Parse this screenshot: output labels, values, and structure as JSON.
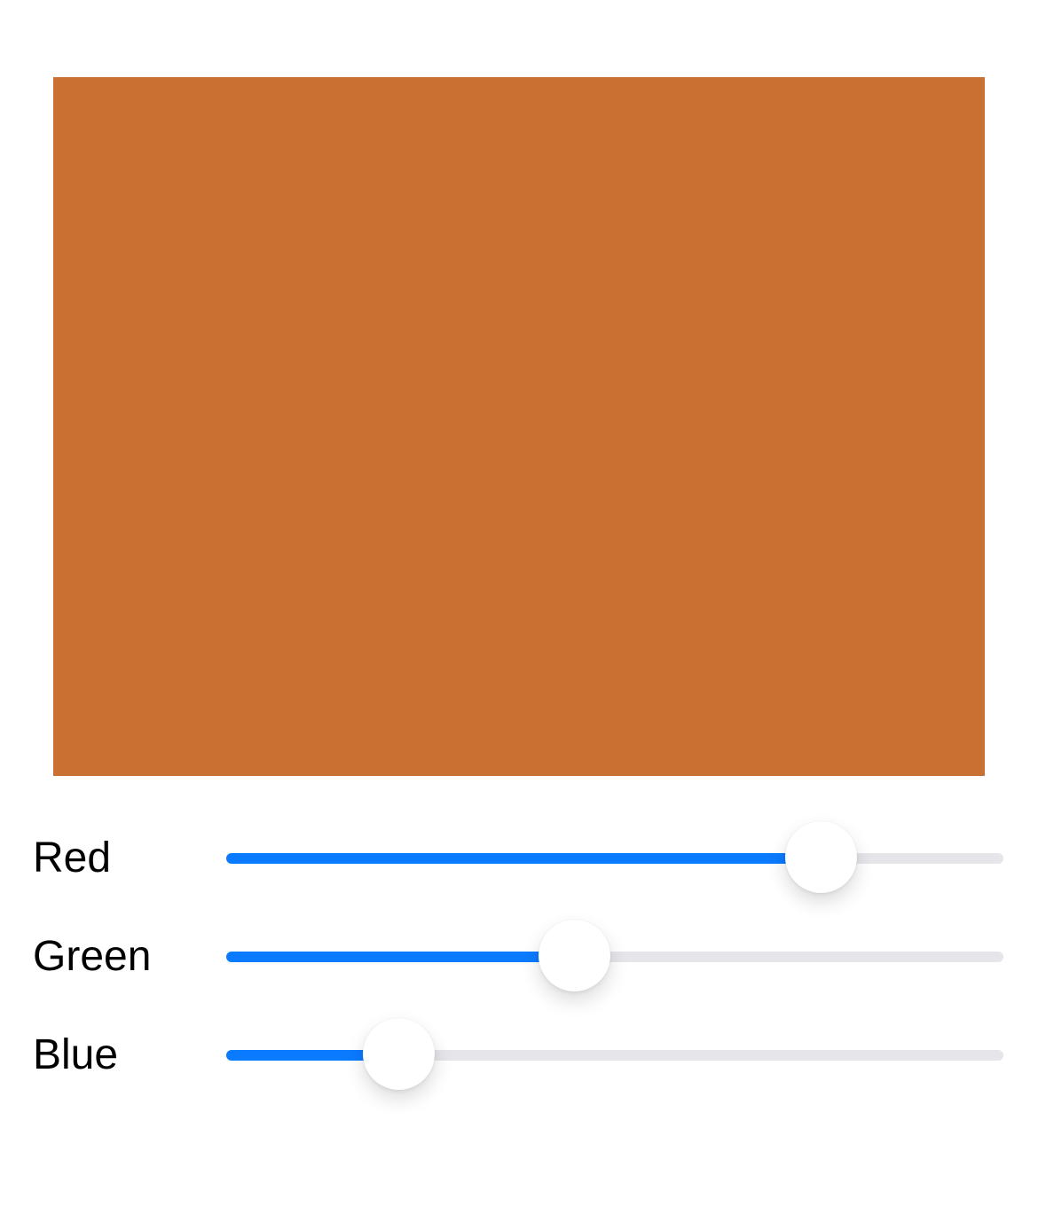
{
  "preview": {
    "color": "#c97133"
  },
  "colors": {
    "track_active": "#0a7aff",
    "track_inactive": "#e5e5ea",
    "thumb": "#ffffff"
  },
  "sliders": [
    {
      "label": "Red",
      "value": 0.765
    },
    {
      "label": "Green",
      "value": 0.447
    },
    {
      "label": "Blue",
      "value": 0.221
    }
  ]
}
